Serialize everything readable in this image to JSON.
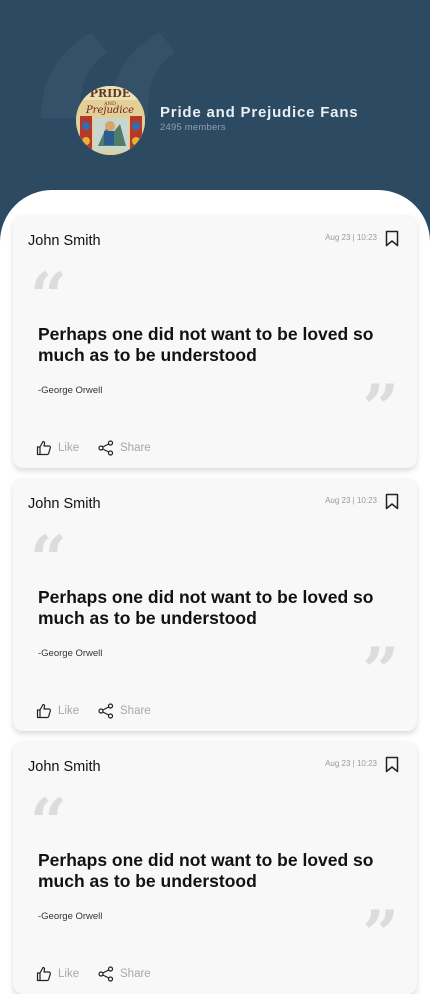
{
  "group": {
    "title": "Pride and Prejudice Fans",
    "members": "2495 members",
    "avatar": {
      "text_line1": "PRIDE",
      "text_line2": "AND",
      "text_line3": "Prejudice"
    }
  },
  "posts": [
    {
      "author": "John Smith",
      "timestamp": "Aug 23 | 10:23",
      "quote": "Perhaps one did not want to be loved so much as to be understood",
      "source": "-George Orwell",
      "like_label": "Like",
      "share_label": "Share"
    },
    {
      "author": "John Smith",
      "timestamp": "Aug 23 | 10:23",
      "quote": "Perhaps one did not want to be loved so much as to be understood",
      "source": "-George Orwell",
      "like_label": "Like",
      "share_label": "Share"
    },
    {
      "author": "John Smith",
      "timestamp": "Aug 23 | 10:23",
      "quote": "Perhaps one did not want to be loved so much as to be understood",
      "source": "-George Orwell",
      "like_label": "Like",
      "share_label": "Share"
    }
  ],
  "colors": {
    "header_bg": "#2d4a63",
    "card_bg": "#f8f8f8",
    "muted": "#a8a8a8",
    "quote_mark": "#dcdcdc"
  },
  "icons": {
    "bookmark": "bookmark-icon",
    "like": "thumbs-up-icon",
    "share": "share-icon"
  }
}
